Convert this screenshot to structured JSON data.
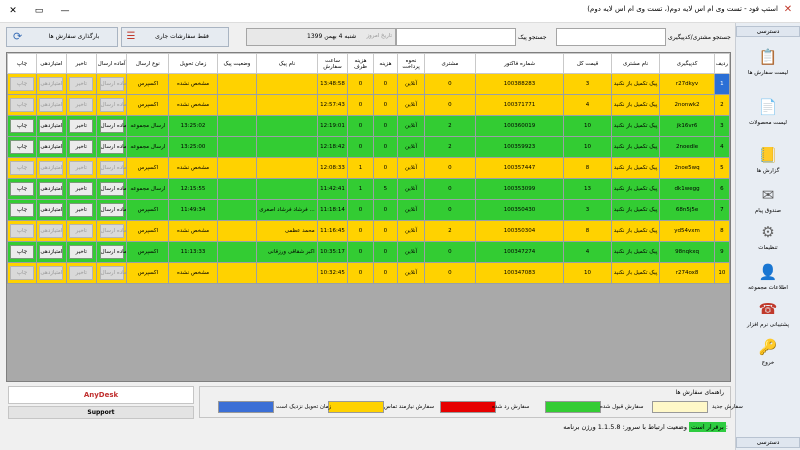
{
  "window": {
    "title": "استپ فود - تست وی ام اس لایه دوم(، تست وی ام اس لایه دوم)"
  },
  "sidebar": {
    "header": "دسترسی",
    "footer": "دسترسی",
    "items": [
      {
        "label": "لیست سفارش ها",
        "icon": "order-list-icon",
        "glyph": "📋",
        "color": "#3b6fb6"
      },
      {
        "label": "لیست محصولات",
        "icon": "product-list-icon",
        "glyph": "📄",
        "color": "#3b6fb6"
      },
      {
        "label": "گزارش ها",
        "icon": "report-icon",
        "glyph": "📒",
        "color": "#d4a017"
      },
      {
        "label": "صندوق پیام",
        "icon": "mail-icon",
        "glyph": "✉",
        "color": "#5a5a5a"
      },
      {
        "label": "تنظیمات",
        "icon": "settings-icon",
        "glyph": "⚙",
        "color": "#666"
      },
      {
        "label": "اطلاعات مجموعه",
        "icon": "company-info-icon",
        "glyph": "👤",
        "color": "#8a5a2b"
      },
      {
        "label": "پشتیبانی نرم افزار",
        "icon": "support-phone-icon",
        "glyph": "☎",
        "color": "#c0392b"
      },
      {
        "label": "خروج",
        "icon": "exit-icon",
        "glyph": "🔑",
        "color": "#c0392b"
      }
    ]
  },
  "toolbar": {
    "search_customer_label": "جستجو مشتری/کدپیگیری",
    "search_customer_value": "",
    "search_peak_label": "جستجو پیک",
    "search_peak_value": "",
    "date_placeholder": "تاریخ امروز",
    "date_value": "شنبه 4 بهمن 1399",
    "current_orders_button": "فقط سفارشات جاری",
    "reload_button": "بارگذاری سفارش ها"
  },
  "grid": {
    "headers": [
      "ردیف",
      "کدپیگیری",
      "نام مشتری",
      "قیمت کل",
      "شماره فاکتور",
      "مشتری",
      "نحوه پرداخت",
      "هزینه",
      "هزینه ظرف",
      "ساعت سفارش",
      "نام پیک",
      "وضعیت پیک",
      "زمان تحویل",
      "نوع ارسال",
      "آماده ارسال",
      "تاخیر",
      "امتیازدهی",
      "چاپ"
    ],
    "buttons": {
      "ready": "آماده ارسال",
      "delay": "تاخیر",
      "rate": "امتیازدهی",
      "print": "چاپ"
    },
    "rows": [
      {
        "idx": "1",
        "code": "r27dkyv",
        "name": "پیک تکمیل باز نکنید",
        "total": "3",
        "invoice": "100388283",
        "cust": "0",
        "pay": "آنلاین",
        "fee": "0",
        "dish": "0",
        "time": "13:48:58",
        "peak": "",
        "status": "",
        "delivery": "مشخص نشده",
        "send": "اکسپرس",
        "color": "#ffd200",
        "enabled": false,
        "selected": true
      },
      {
        "idx": "2",
        "code": "2nonwk2",
        "name": "پیک تکمیل باز نکنید",
        "total": "4",
        "invoice": "100371771",
        "cust": "0",
        "pay": "آنلاین",
        "fee": "0",
        "dish": "0",
        "time": "12:57:43",
        "peak": "",
        "status": "",
        "delivery": "مشخص نشده",
        "send": "اکسپرس",
        "color": "#ffd200",
        "enabled": false,
        "selected": false
      },
      {
        "idx": "3",
        "code": "jk16vr6",
        "name": "پیک تکمیل باز نکنید",
        "total": "10",
        "invoice": "100360019",
        "cust": "2",
        "pay": "آنلاین",
        "fee": "0",
        "dish": "0",
        "time": "12:19:01",
        "peak": "",
        "status": "",
        "delivery": "13:25:02",
        "send": "ارسال مجموعه",
        "color": "#33cc33",
        "enabled": true,
        "selected": false
      },
      {
        "idx": "4",
        "code": "2noedle",
        "name": "پیک تکمیل باز نکنید",
        "total": "10",
        "invoice": "100359923",
        "cust": "2",
        "pay": "آنلاین",
        "fee": "0",
        "dish": "0",
        "time": "12:18:42",
        "peak": "",
        "status": "",
        "delivery": "13:25:00",
        "send": "ارسال مجموعه",
        "color": "#33cc33",
        "enabled": true,
        "selected": false
      },
      {
        "idx": "5",
        "code": "2noe5wq",
        "name": "پیک تکمیل باز نکنید",
        "total": "8",
        "invoice": "100357447",
        "cust": "0",
        "pay": "آنلاین",
        "fee": "0",
        "dish": "1",
        "time": "12:08:33",
        "peak": "",
        "status": "",
        "delivery": "مشخص نشده",
        "send": "اکسپرس",
        "color": "#ffd200",
        "enabled": false,
        "selected": false
      },
      {
        "idx": "6",
        "code": "dk1wegg",
        "name": "پیک تکمیل باز نکنید",
        "total": "13",
        "invoice": "100353099",
        "cust": "0",
        "pay": "آنلاین",
        "fee": "5",
        "dish": "1",
        "time": "11:42:41",
        "peak": "",
        "status": "",
        "delivery": "12:15:55",
        "send": "ارسال مجموعه",
        "color": "#33cc33",
        "enabled": true,
        "selected": false
      },
      {
        "idx": "7",
        "code": "68n5j5e",
        "name": "پیک تکمیل باز نکنید",
        "total": "3",
        "invoice": "100350430",
        "cust": "0",
        "pay": "آنلاین",
        "fee": "0",
        "dish": "0",
        "time": "11:18:14",
        "peak": "فرشاد فرشاد اصغری ...",
        "status": "",
        "delivery": "11:49:34",
        "send": "اکسپرس",
        "color": "#33cc33",
        "enabled": true,
        "selected": false
      },
      {
        "idx": "8",
        "code": "yd54vxm",
        "name": "پیک تکمیل باز نکنید",
        "total": "8",
        "invoice": "100350304",
        "cust": "2",
        "pay": "آنلاین",
        "fee": "0",
        "dish": "0",
        "time": "11:16:45",
        "peak": "محمد عظمی",
        "status": "",
        "delivery": "مشخص نشده",
        "send": "اکسپرس",
        "color": "#ffd200",
        "enabled": false,
        "selected": false
      },
      {
        "idx": "9",
        "code": "98nqkxq",
        "name": "پیک تکمیل باز نکنید",
        "total": "4",
        "invoice": "100347274",
        "cust": "0",
        "pay": "آنلاین",
        "fee": "0",
        "dish": "0",
        "time": "10:35:17",
        "peak": "اکبر شقاقی ورزقانی",
        "status": "",
        "delivery": "11:13:33",
        "send": "اکسپرس",
        "color": "#33cc33",
        "enabled": true,
        "selected": false
      },
      {
        "idx": "10",
        "code": "r274ox8",
        "name": "پیک تکمیل باز نکنید",
        "total": "10",
        "invoice": "100347083",
        "cust": "0",
        "pay": "آنلاین",
        "fee": "0",
        "dish": "0",
        "time": "10:32:45",
        "peak": "",
        "status": "",
        "delivery": "مشخص نشده",
        "send": "اکسپرس",
        "color": "#ffd200",
        "enabled": false,
        "selected": false
      }
    ]
  },
  "legend": {
    "title": "راهنمای سفارش ها",
    "items": [
      {
        "label": "سفارش جدید",
        "color": "#fff8c8"
      },
      {
        "label": "سفارش قبول شده",
        "color": "#33cc33"
      },
      {
        "label": "سفارش رد شده",
        "color": "#e60000"
      },
      {
        "label": "سفارش نیازمند تماس",
        "color": "#ffd200"
      },
      {
        "label": "زمان تحویل نزدیک است",
        "color": "#3b6fd6"
      }
    ]
  },
  "anydesk": "AnyDesk",
  "support": "Support",
  "status": {
    "version_label": "ورژن برنامه:",
    "version": "1.1.5.8",
    "connection_label": "وضعیت ارتباط با سرور:",
    "connection": "برقرار است"
  }
}
